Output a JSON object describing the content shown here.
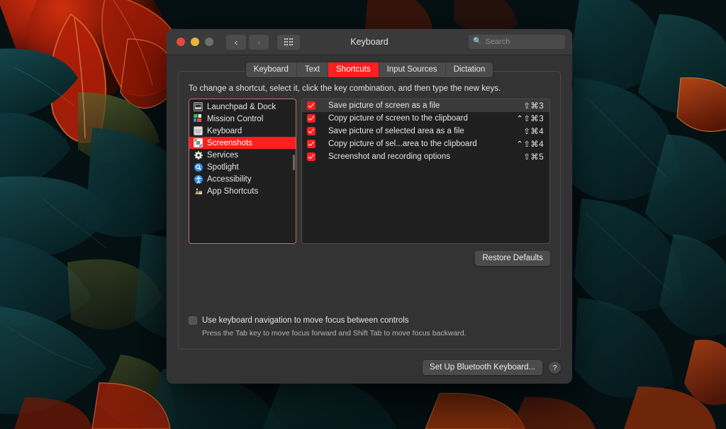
{
  "window": {
    "title": "Keyboard",
    "traffic_lights": [
      "close",
      "minimize",
      "zoom"
    ],
    "nav_back_icon": "chevron-left-icon",
    "nav_forward_icon": "chevron-right-icon",
    "grid_icon": "grid-view-icon",
    "search": {
      "placeholder": "Search",
      "value": "",
      "icon": "search-icon"
    }
  },
  "tabs": [
    {
      "label": "Keyboard",
      "active": false
    },
    {
      "label": "Text",
      "active": false
    },
    {
      "label": "Shortcuts",
      "active": true
    },
    {
      "label": "Input Sources",
      "active": false
    },
    {
      "label": "Dictation",
      "active": false
    }
  ],
  "instruction": "To change a shortcut, select it, click the key combination, and then type the new keys.",
  "sidebar": {
    "items": [
      {
        "label": "Launchpad & Dock",
        "icon": "launchpad-dock-icon",
        "selected": false
      },
      {
        "label": "Mission Control",
        "icon": "mission-control-icon",
        "selected": false
      },
      {
        "label": "Keyboard",
        "icon": "keyboard-icon",
        "selected": false
      },
      {
        "label": "Screenshots",
        "icon": "screenshots-icon",
        "selected": true
      },
      {
        "label": "Services",
        "icon": "services-gear-icon",
        "selected": false
      },
      {
        "label": "Spotlight",
        "icon": "spotlight-icon",
        "selected": false
      },
      {
        "label": "Accessibility",
        "icon": "accessibility-icon",
        "selected": false
      },
      {
        "label": "App Shortcuts",
        "icon": "app-shortcuts-icon",
        "selected": false
      }
    ]
  },
  "shortcuts": [
    {
      "label": "Save picture of screen as a file",
      "keys": "⇧⌘3",
      "checked": true,
      "highlighted": true
    },
    {
      "label": "Copy picture of screen to the clipboard",
      "keys": "⌃⇧⌘3",
      "checked": true,
      "highlighted": false
    },
    {
      "label": "Save picture of selected area as a file",
      "keys": "⇧⌘4",
      "checked": true,
      "highlighted": false
    },
    {
      "label": "Copy picture of sel...area to the clipboard",
      "keys": "⌃⇧⌘4",
      "checked": true,
      "highlighted": false
    },
    {
      "label": "Screenshot and recording options",
      "keys": "⇧⌘5",
      "checked": true,
      "highlighted": false
    }
  ],
  "buttons": {
    "restore_defaults": "Restore Defaults",
    "set_up_bluetooth_keyboard": "Set Up Bluetooth Keyboard...",
    "help": "?"
  },
  "keyboard_navigation": {
    "label": "Use keyboard navigation to move focus between controls",
    "hint": "Press the Tab key to move focus forward and Shift Tab to move focus backward.",
    "checked": false
  },
  "colors": {
    "accent_red": "#ff1f1f",
    "window_bg": "#333333",
    "titlebar_bg": "#3a3a3a",
    "list_bg": "#1f1f1f",
    "sidebar_border": "#c76b78",
    "text": "#e6e6e6"
  }
}
